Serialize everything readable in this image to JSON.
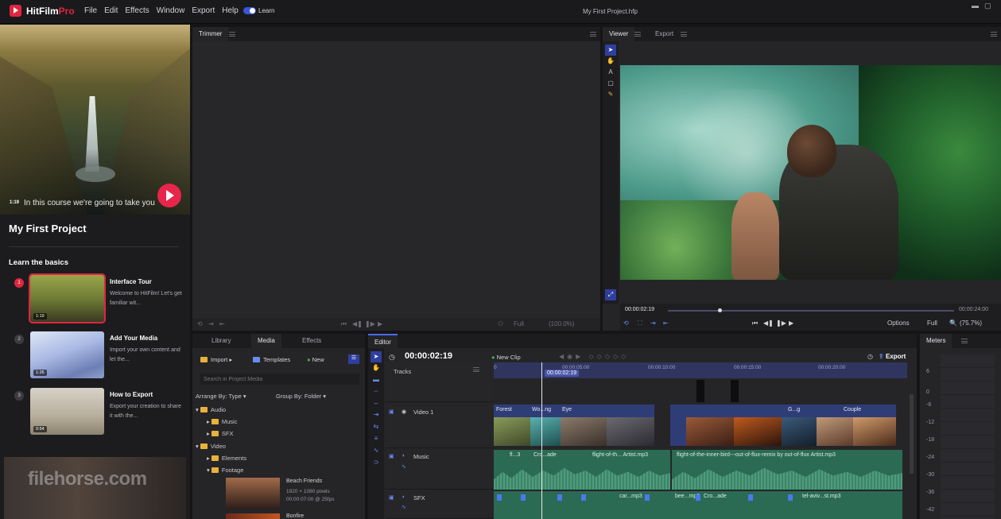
{
  "app": {
    "name": "HitFilm",
    "edition": "Pro",
    "menu": [
      "File",
      "Edit",
      "Effects",
      "Window",
      "Export",
      "Help"
    ],
    "learn_toggle": "Learn",
    "project_title": "My First Project.hfp"
  },
  "learn_panel": {
    "hero_badge": "1:19",
    "hero_caption": "In this course we're going to take you",
    "course_title": "My First Project",
    "section_title": "Learn the basics",
    "lessons": [
      {
        "num": "1",
        "title": "Interface Tour",
        "desc": "Welcome to HitFilm! Let's get familiar wit...",
        "duration": "1:19"
      },
      {
        "num": "2",
        "title": "Add Your Media",
        "desc": "Import your own content and let the...",
        "duration": "1:26"
      },
      {
        "num": "3",
        "title": "How to Export",
        "desc": "Export your creation to share it with the...",
        "duration": "0:54"
      }
    ],
    "watermark": "filehorse.com"
  },
  "trimmer": {
    "tab": "Trimmer",
    "quality": "Full",
    "zoom": "(100.0%)"
  },
  "viewer": {
    "tabs": [
      "Viewer",
      "Export"
    ],
    "current_time": "00:00:02:19",
    "end_time": "00:00:24:00",
    "options": "Options",
    "quality": "Full",
    "zoom": "(75.7%)",
    "scrub_progress": 0.18
  },
  "library": {
    "tabs": [
      "Library",
      "Media",
      "Effects"
    ],
    "import": "Import",
    "templates": "Templates",
    "new": "New",
    "search_placeholder": "Search in Project Media",
    "arrange": "Arrange By: Type",
    "group": "Group By: Folder",
    "tree": [
      "Audio",
      "Music",
      "SFX",
      "Video",
      "Elements",
      "Footage"
    ],
    "media_items": [
      {
        "name": "Beach Friends",
        "info1": "1920 × 1080 pixels",
        "info2": "00:00:07:00 @ 25fps"
      },
      {
        "name": "Bonfire"
      }
    ]
  },
  "editor": {
    "tab": "Editor",
    "timecode": "00:00:02:19",
    "new_clip": "New Clip",
    "export": "Export",
    "tracks_label": "Tracks",
    "ruler": [
      "0",
      "00:00:05:00",
      "00:00:10:00",
      "00:00:15:00",
      "00:00:20:00"
    ],
    "playhead": "00:00:02:19",
    "tracks": [
      {
        "name": "Video 1",
        "clips": [
          "Forest",
          "Wo...ng",
          "Eye",
          "G...g",
          "Couple"
        ]
      },
      {
        "name": "Music",
        "clips": [
          "fl...3",
          "Cro...ade",
          "flight-of-th... Artist.mp3",
          "flight-of-the-inner-bird---out-of-flux-remix by out-of-flux Artist.mp3"
        ]
      },
      {
        "name": "SFX",
        "clips": [
          "car...mp3",
          "bee...mp3",
          "Cro...ade",
          "tel-aviv...st.mp3"
        ]
      }
    ]
  },
  "meters": {
    "tab": "Meters",
    "scale": [
      "6",
      "0",
      "-6",
      "-12",
      "-18",
      "-24",
      "-30",
      "-36",
      "-42"
    ]
  }
}
